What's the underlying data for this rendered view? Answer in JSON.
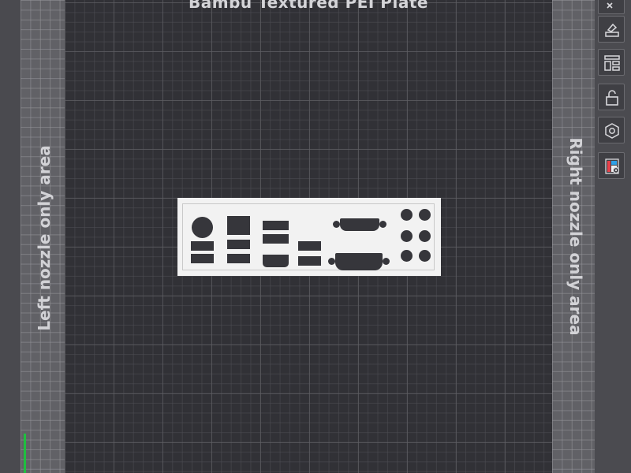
{
  "plate": {
    "title": "Bambu Textured PEI Plate"
  },
  "labels": {
    "left_zone": "Left nozzle only area",
    "right_zone": "Right nozzle only area"
  },
  "toolbar": {
    "icons": [
      "close-icon",
      "auto-orient-icon",
      "arrange-icon",
      "lock-icon",
      "settings-icon",
      "color-paint-icon"
    ]
  },
  "colors": {
    "plate_bg": "#313136",
    "nozzle_zone_bg": "#616166",
    "model_fill": "#f2f2f2",
    "axis_green": "#1fbf3f"
  }
}
